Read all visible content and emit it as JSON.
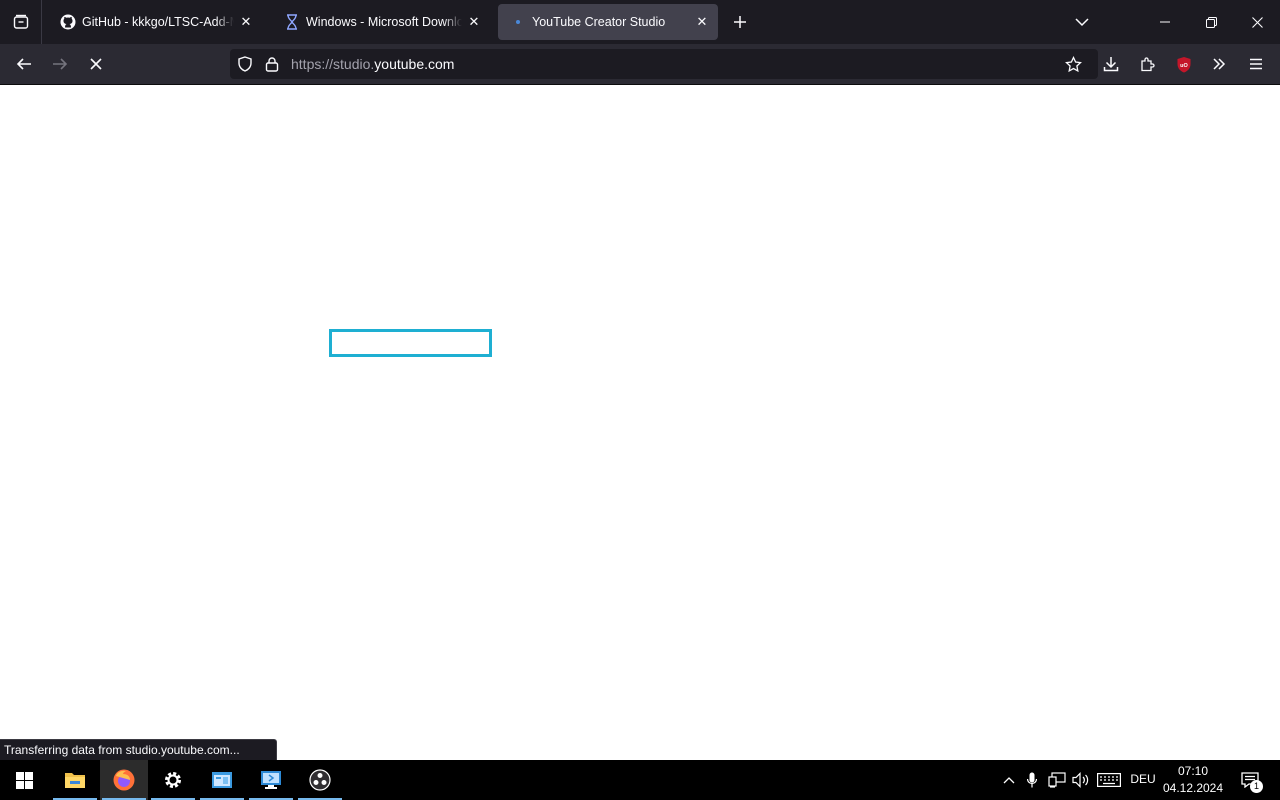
{
  "browser": {
    "tabs": [
      {
        "title": "GitHub - kkkgo/LTSC-Add-MicrosoftStore",
        "favicon": "github-icon",
        "selected": false
      },
      {
        "title": "Windows - Microsoft Download",
        "favicon": "hourglass-icon",
        "selected": false
      },
      {
        "title": "YouTube Creator Studio",
        "favicon": "loading-dot-icon",
        "selected": true
      }
    ],
    "url": {
      "prefix": "https://studio.",
      "domain": "youtube.com"
    },
    "status_text": "Transferring data from studio.youtube.com...",
    "colors": {
      "tabstrip": "#1c1b22",
      "navbar": "#2b2a33",
      "selected_tab": "#42414d",
      "loading_box_border": "#1eafd2",
      "ublock": "#c4162a"
    }
  },
  "taskbar": {
    "apps": [
      "start-icon",
      "file-explorer-icon",
      "firefox-icon",
      "settings-icon",
      "control-panel-icon",
      "remote-desktop-icon",
      "obs-icon"
    ],
    "language": "DEU",
    "time": "07:10",
    "date": "04.12.2024",
    "notification_count": "1"
  }
}
